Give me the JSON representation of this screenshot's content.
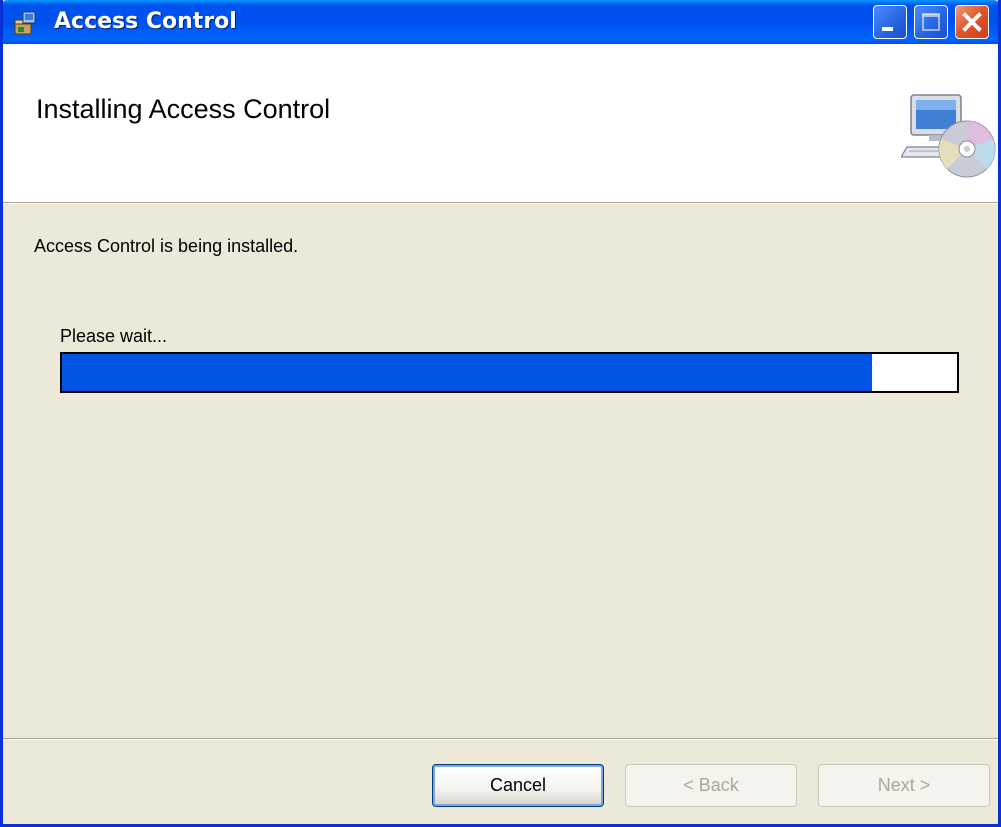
{
  "window": {
    "title": "Access Control",
    "title_icon": "installer-package-icon",
    "controls": {
      "minimize_icon": "minimize-icon",
      "maximize_icon": "maximize-icon",
      "close_icon": "close-icon"
    }
  },
  "header": {
    "title": "Installing Access Control",
    "icon": "computer-cd-icon"
  },
  "body": {
    "status": "Access Control is being installed.",
    "wait_label": "Please wait...",
    "progress_fraction": 0.905
  },
  "buttons": {
    "cancel": "Cancel",
    "back": "< Back",
    "next": "Next >"
  },
  "colors": {
    "titlebar": "#0053ee",
    "progress_fill": "#0055e5",
    "dialog_bg": "#ece9d8"
  }
}
